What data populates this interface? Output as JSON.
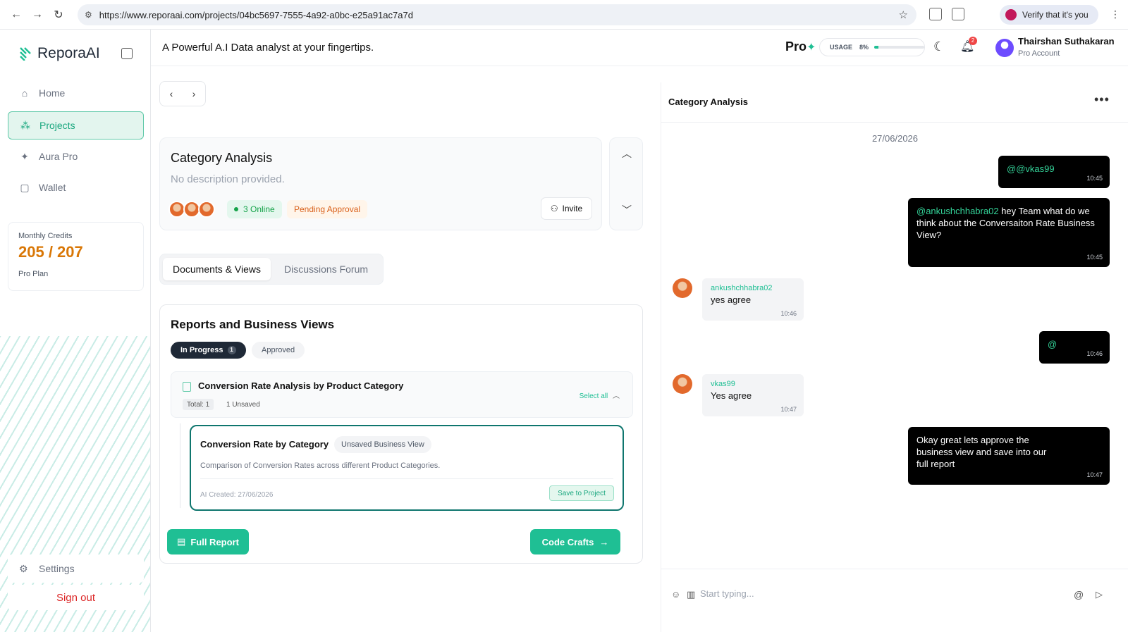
{
  "browser": {
    "url": "https://www.reporaai.com/projects/04bc5697-7555-4a92-a0bc-e25a91ac7a7d",
    "verify_label": "Verify that it's you"
  },
  "sidebar": {
    "logo": "ReporaAI",
    "items": [
      {
        "label": "Home",
        "icon": "home-icon",
        "active": false
      },
      {
        "label": "Projects",
        "icon": "projects-icon",
        "active": true
      },
      {
        "label": "Aura Pro",
        "icon": "magic-wand-icon",
        "active": false
      },
      {
        "label": "Wallet",
        "icon": "wallet-icon",
        "active": false
      }
    ],
    "credits": {
      "label": "Monthly Credits",
      "value": "205 / 207",
      "plan": "Pro Plan"
    },
    "settings": "Settings",
    "signout": "Sign out"
  },
  "topbar": {
    "tagline": "A Powerful A.I Data analyst at your fingertips.",
    "pro_label": "Pro",
    "usage_label": "USAGE",
    "usage_value": "8%",
    "usage_fraction": 0.08,
    "notifications": "2",
    "user_name": "Thairshan Suthakaran",
    "user_role": "Pro Account"
  },
  "project": {
    "title": "Category Analysis",
    "description": "No description provided.",
    "online": "3 Online",
    "status": "Pending Approval",
    "invite": "Invite"
  },
  "tabs": [
    {
      "label": "Documents & Views",
      "active": true
    },
    {
      "label": "Discussions Forum",
      "active": false
    }
  ],
  "reports": {
    "title": "Reports and Business Views",
    "filters": {
      "in_progress": "In Progress",
      "in_progress_count": "1",
      "approved": "Approved"
    },
    "group": {
      "title": "Conversion Rate Analysis by Product Category",
      "total": "Total: 1",
      "unsaved": "1 Unsaved",
      "select_all": "Select all"
    },
    "view": {
      "title": "Conversion Rate by Category",
      "badge": "Unsaved Business View",
      "description": "Comparison of Conversion Rates across different Product Categories.",
      "created": "AI Created: 27/06/2026",
      "save": "Save to Project"
    },
    "full_report": "Full Report",
    "code_crafts": "Code Crafts"
  },
  "chat": {
    "title": "Category Analysis",
    "date": "27/06/2026",
    "messages": [
      {
        "mention": "@@vkas99",
        "text": "",
        "time": "10:45"
      },
      {
        "mention": "@ankushchhabra02",
        "text": " hey Team what do we think about the Conversaiton Rate Business View?",
        "time": "10:45"
      },
      {
        "who": "ankushchhabra02",
        "text": "yes agree",
        "time": "10:46"
      },
      {
        "mention": "@",
        "text": "",
        "time": "10:46"
      },
      {
        "who": "vkas99",
        "text": "Yes agree",
        "time": "10:47"
      },
      {
        "mention": "",
        "text": "Okay great lets approve the business view and save into our full report",
        "time": "10:47"
      }
    ],
    "placeholder": "Start typing..."
  },
  "colors": {
    "accent": "#1fbf94",
    "warning": "#d97706",
    "danger": "#dc2626"
  }
}
